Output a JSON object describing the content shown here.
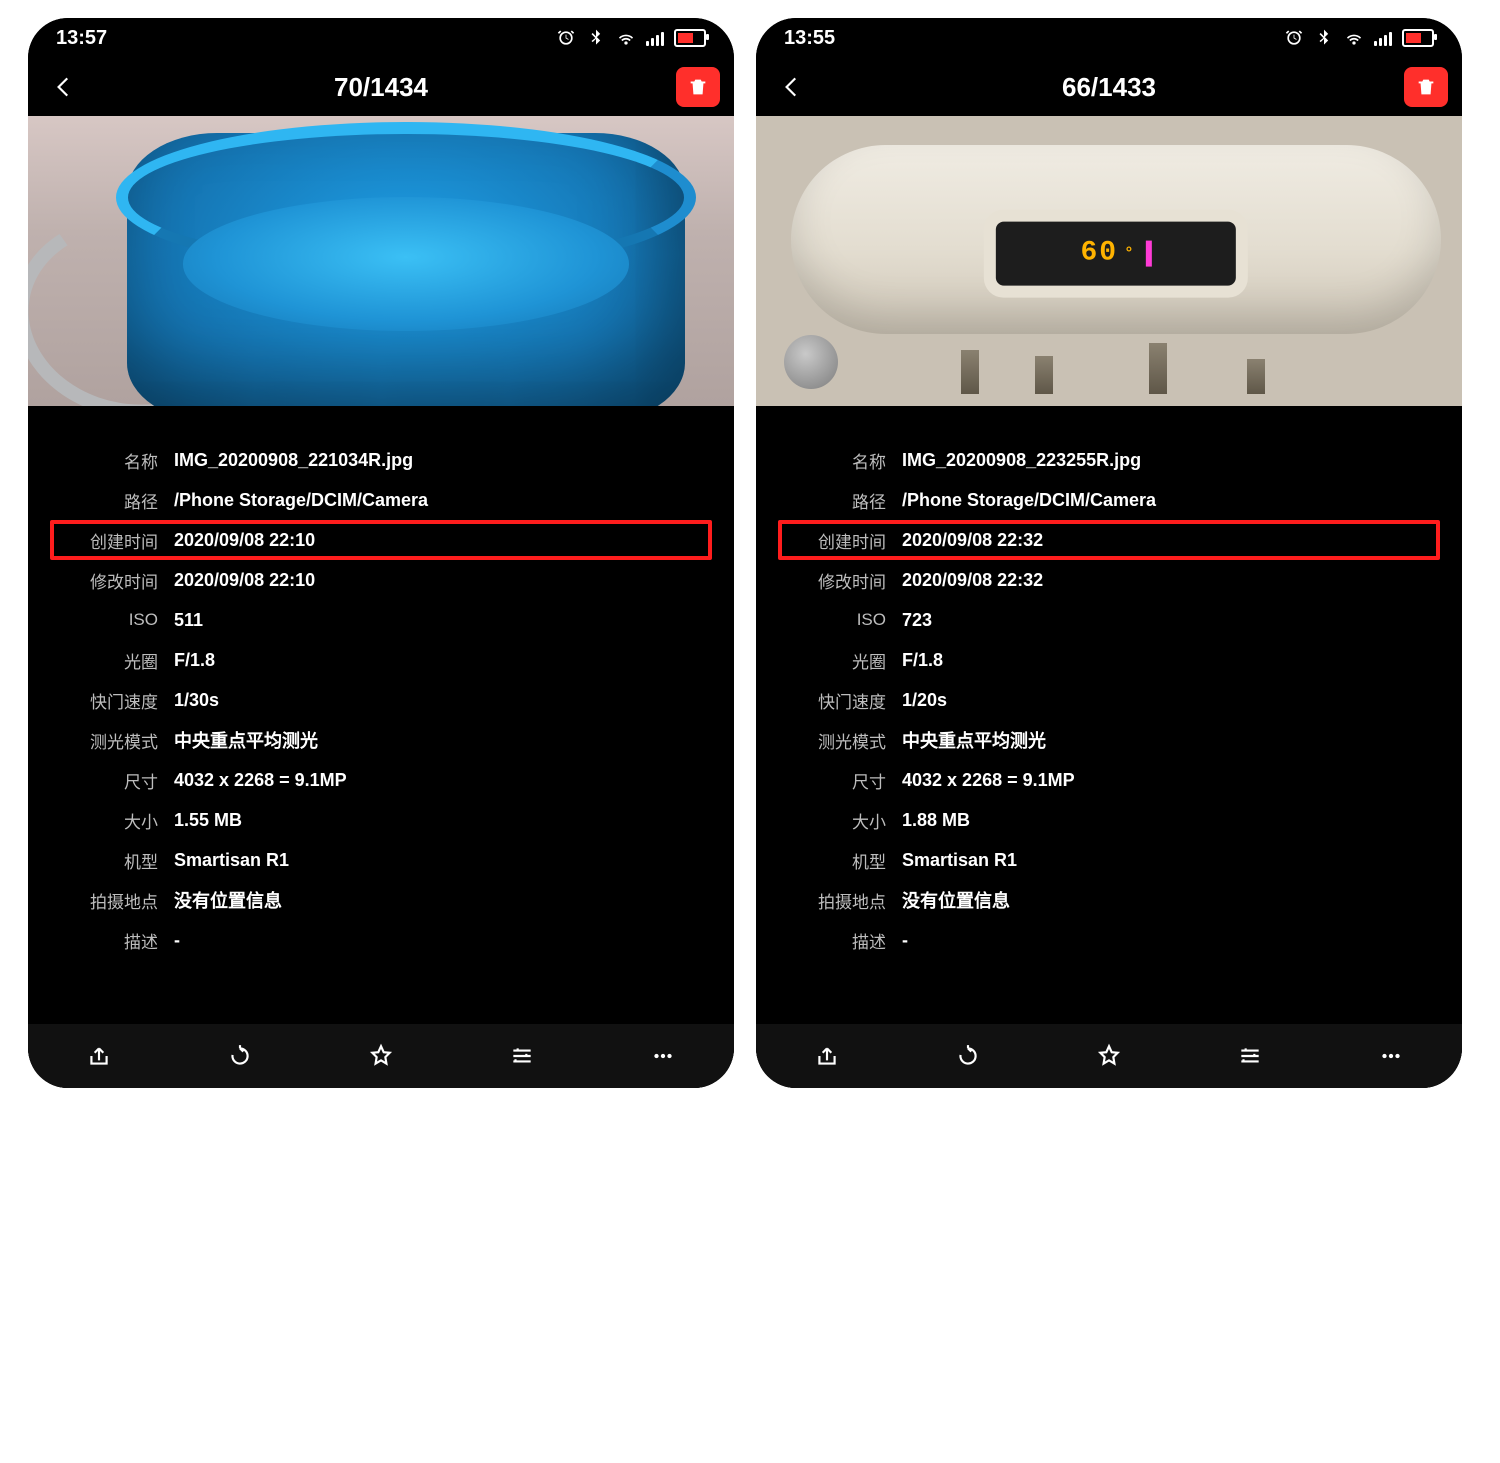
{
  "phones": [
    {
      "status": {
        "time": "13:57"
      },
      "header": {
        "title": "70/1434"
      },
      "image": {
        "kind": "bucket"
      },
      "rows": [
        {
          "label": "名称",
          "value": "IMG_20200908_221034R.jpg",
          "highlight": false
        },
        {
          "label": "路径",
          "value": "/Phone Storage/DCIM/Camera",
          "highlight": false
        },
        {
          "label": "创建时间",
          "value": "2020/09/08 22:10",
          "highlight": true
        },
        {
          "label": "修改时间",
          "value": "2020/09/08 22:10",
          "highlight": false
        },
        {
          "label": "ISO",
          "value": "511",
          "highlight": false
        },
        {
          "label": "光圈",
          "value": "F/1.8",
          "highlight": false
        },
        {
          "label": "快门速度",
          "value": "1/30s",
          "highlight": false
        },
        {
          "label": "测光模式",
          "value": "中央重点平均测光",
          "highlight": false
        },
        {
          "label": "尺寸",
          "value": "4032 x 2268 = 9.1MP",
          "highlight": false
        },
        {
          "label": "大小",
          "value": "1.55 MB",
          "highlight": false
        },
        {
          "label": "机型",
          "value": "Smartisan R1",
          "highlight": false
        },
        {
          "label": "拍摄地点",
          "value": "没有位置信息",
          "highlight": false
        },
        {
          "label": "描述",
          "value": "-",
          "highlight": false
        }
      ]
    },
    {
      "status": {
        "time": "13:55"
      },
      "header": {
        "title": "66/1433"
      },
      "image": {
        "kind": "heater",
        "led": "60"
      },
      "rows": [
        {
          "label": "名称",
          "value": "IMG_20200908_223255R.jpg",
          "highlight": false
        },
        {
          "label": "路径",
          "value": "/Phone Storage/DCIM/Camera",
          "highlight": false
        },
        {
          "label": "创建时间",
          "value": "2020/09/08 22:32",
          "highlight": true
        },
        {
          "label": "修改时间",
          "value": "2020/09/08 22:32",
          "highlight": false
        },
        {
          "label": "ISO",
          "value": "723",
          "highlight": false
        },
        {
          "label": "光圈",
          "value": "F/1.8",
          "highlight": false
        },
        {
          "label": "快门速度",
          "value": "1/20s",
          "highlight": false
        },
        {
          "label": "测光模式",
          "value": "中央重点平均测光",
          "highlight": false
        },
        {
          "label": "尺寸",
          "value": "4032 x 2268 = 9.1MP",
          "highlight": false
        },
        {
          "label": "大小",
          "value": "1.88 MB",
          "highlight": false
        },
        {
          "label": "机型",
          "value": "Smartisan R1",
          "highlight": false
        },
        {
          "label": "拍摄地点",
          "value": "没有位置信息",
          "highlight": false
        },
        {
          "label": "描述",
          "value": "-",
          "highlight": false
        }
      ]
    }
  ]
}
